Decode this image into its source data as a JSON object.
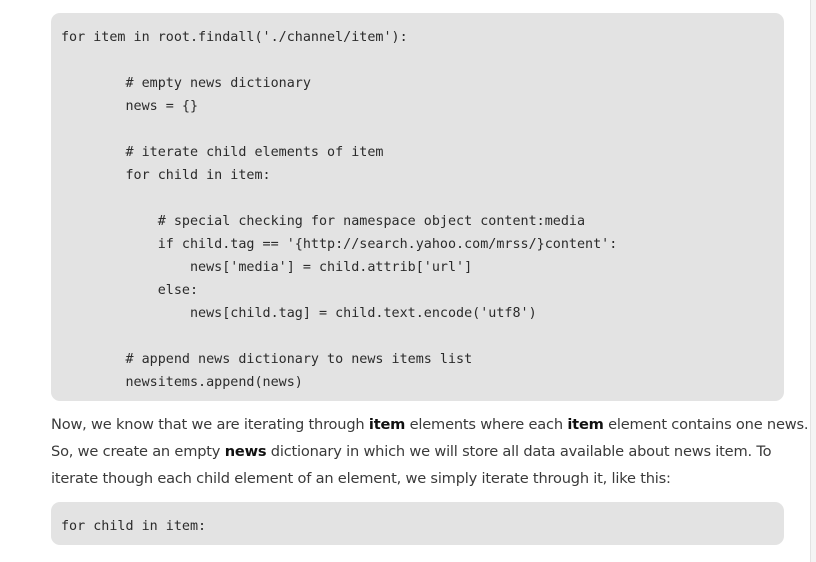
{
  "code_block_main": {
    "lines": [
      "for item in root.findall('./channel/item'):",
      "",
      "        # empty news dictionary",
      "        news = {}",
      "",
      "        # iterate child elements of item",
      "        for child in item:",
      "",
      "            # special checking for namespace object content:media",
      "            if child.tag == '{http://search.yahoo.com/mrss/}content':",
      "                news['media'] = child.attrib['url']",
      "            else:",
      "                news[child.tag] = child.text.encode('utf8')",
      "",
      "        # append news dictionary to news items list",
      "        newsitems.append(news)"
    ]
  },
  "paragraph": {
    "line1": {
      "t1": "Now, we know that we are iterating through ",
      "b1": "item",
      "t2": " elements where each ",
      "b2": "item",
      "t3": " element contains one news."
    },
    "line2": {
      "t1": "So, we create an empty ",
      "b1": "news",
      "t2": " dictionary in which we will store all data available about news item. To"
    },
    "line3": {
      "t1": "iterate though each child element of an element, we simply iterate through it, like this:"
    }
  },
  "code_block_small": {
    "lines": [
      "for child in item:"
    ]
  }
}
